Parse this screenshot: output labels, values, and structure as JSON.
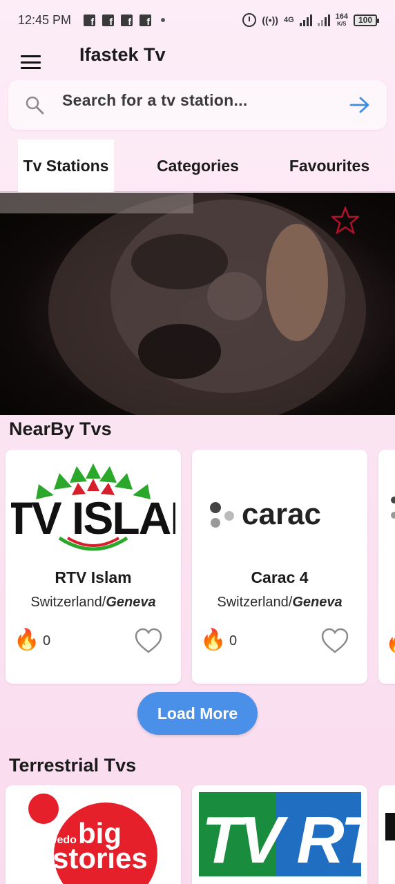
{
  "status_bar": {
    "time": "12:45 PM",
    "network": "4G",
    "speed_value": "164",
    "speed_unit": "K/S",
    "battery": "100"
  },
  "app_bar": {
    "title": "Ifastek Tv"
  },
  "search": {
    "placeholder": "Search for a tv station..."
  },
  "tabs": [
    {
      "label": "Tv Stations",
      "active": true
    },
    {
      "label": "Categories",
      "active": false
    },
    {
      "label": "Favourites",
      "active": false
    }
  ],
  "nearby": {
    "title": "NearBy Tvs",
    "cards": [
      {
        "logo_text": "TV ISLAI",
        "name": "RTV Islam",
        "country": "Switzerland/",
        "city": "Geneva",
        "views": "0"
      },
      {
        "logo_text": "carac",
        "name": "Carac 4",
        "country": "Switzerland/",
        "city": "Geneva",
        "views": "0"
      }
    ],
    "load_more": "Load More"
  },
  "terrestrial": {
    "title": "Terrestrial Tvs",
    "cards": [
      {
        "logo_text_1": "wedo",
        "logo_text_2": "big",
        "logo_text_3": "stories"
      },
      {
        "logo_text": "TV RT"
      }
    ]
  },
  "colors": {
    "accent": "#4a90e8",
    "background": "#fbe2f1",
    "fire": "#f57c00"
  }
}
